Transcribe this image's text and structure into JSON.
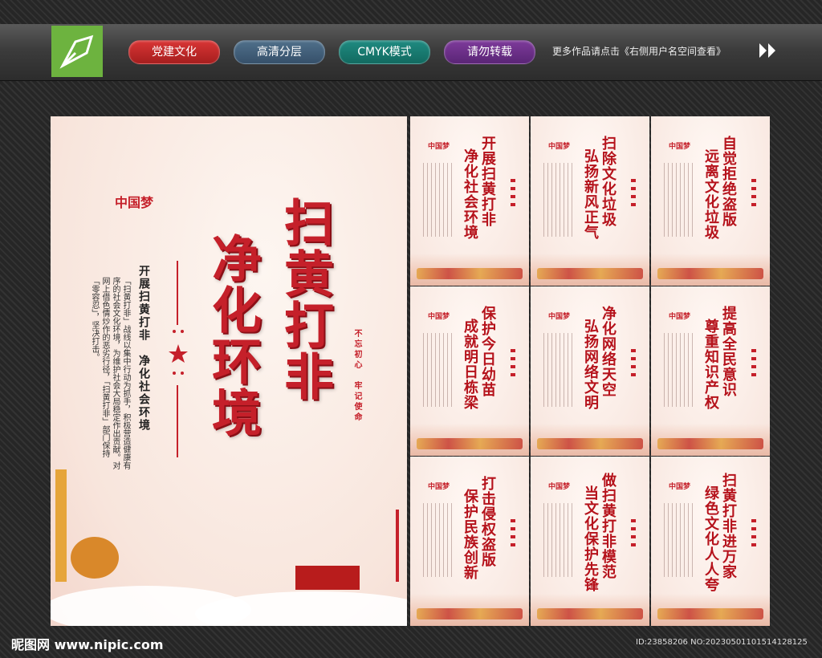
{
  "header": {
    "tags": [
      "党建文化",
      "高清分层",
      "CMYK模式",
      "请勿转载"
    ],
    "more_text": "更多作品请点击《右侧用户名空间查看》"
  },
  "main_poster": {
    "logo_text": "中国梦",
    "headline_1": "扫黄打非",
    "headline_2": "净化环境",
    "side_title": "开展扫黄打非　净化社会环境",
    "side_body": "「扫黄打非」战线以集中行动为抓手，积极营造健康有序的社会文化环境，为维护社会大局稳定作出贡献。对网上借色情炒作的恶劣行径，「扫黄打非」部门保持「零容忍」，坚决打击。",
    "stamp": "不忘初心　牢记使命"
  },
  "small_posters": [
    {
      "line1": "开展扫黄打非",
      "line2": "净化社会环境"
    },
    {
      "line1": "扫除文化垃圾",
      "line2": "弘扬新风正气"
    },
    {
      "line1": "自觉拒绝盗版",
      "line2": "远离文化垃圾"
    },
    {
      "line1": "保护今日幼苗",
      "line2": "成就明日栋梁"
    },
    {
      "line1": "净化网络天空",
      "line2": "弘扬网络文明"
    },
    {
      "line1": "提高全民意识",
      "line2": "尊重知识产权"
    },
    {
      "line1": "打击侵权盗版",
      "line2": "保护民族创新"
    },
    {
      "line1": "做扫黄打非模范",
      "line2": "当文化保护先锋"
    },
    {
      "line1": "扫黄打非进万家",
      "line2": "绿色文化人人夸"
    }
  ],
  "footer": {
    "site": "昵图网 www.nipic.com",
    "id": "ID:23858206 NO:20230501101514128125"
  }
}
